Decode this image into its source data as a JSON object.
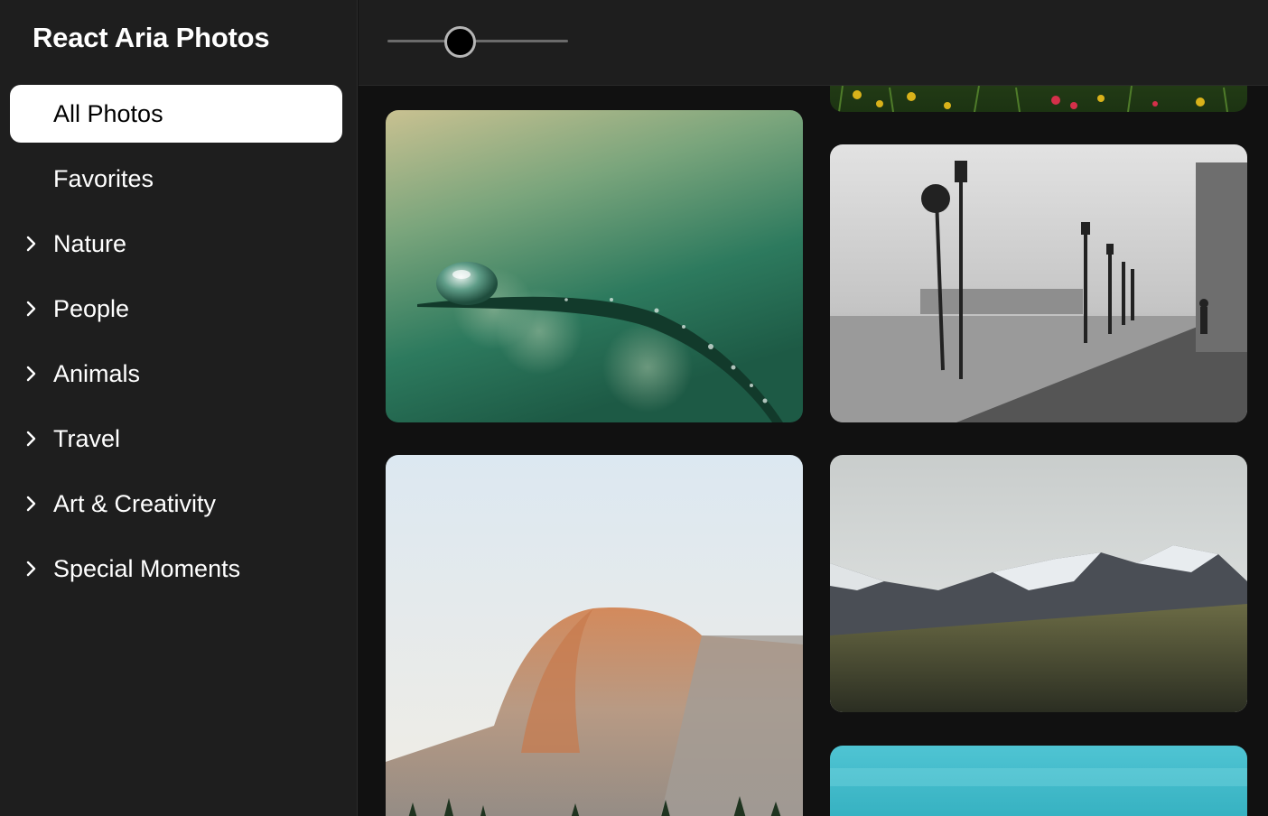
{
  "app": {
    "title": "React Aria Photos"
  },
  "sidebar": {
    "items": [
      {
        "label": "All Photos",
        "selected": true,
        "expandable": false
      },
      {
        "label": "Favorites",
        "selected": false,
        "expandable": false
      },
      {
        "label": "Nature",
        "selected": false,
        "expandable": true
      },
      {
        "label": "People",
        "selected": false,
        "expandable": true
      },
      {
        "label": "Animals",
        "selected": false,
        "expandable": true
      },
      {
        "label": "Travel",
        "selected": false,
        "expandable": true
      },
      {
        "label": "Art & Creativity",
        "selected": false,
        "expandable": true
      },
      {
        "label": "Special Moments",
        "selected": false,
        "expandable": true
      }
    ]
  },
  "toolbar": {
    "zoom_slider": {
      "value_fraction": 0.4
    }
  },
  "gallery": {
    "photos": [
      {
        "name": "wildflowers"
      },
      {
        "name": "water-droplet-on-grass"
      },
      {
        "name": "foggy-waterfront-promenade"
      },
      {
        "name": "half-dome-mountain"
      },
      {
        "name": "snowy-mountain-valley"
      },
      {
        "name": "turquoise-water"
      }
    ]
  },
  "colors": {
    "sidebar_bg": "#1e1e1e",
    "gallery_bg": "#111111",
    "selected_bg": "#ffffff",
    "text": "#ffffff"
  }
}
